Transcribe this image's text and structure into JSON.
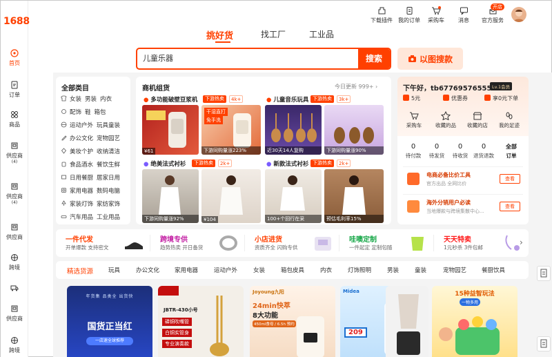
{
  "brand": {
    "logo": "1688",
    "accent": "#ff4000"
  },
  "sidebar": {
    "items": [
      {
        "label": "首页",
        "icon": "home-icon",
        "active": true
      },
      {
        "label": "订单",
        "icon": "order-icon"
      },
      {
        "label": "商品",
        "icon": "grid-icon"
      },
      {
        "label": "供应商",
        "sub": "(4)",
        "icon": "supplier-icon"
      },
      {
        "label": "供应商",
        "sub": "(4)",
        "icon": "supplier-icon"
      },
      {
        "label": "供应商",
        "icon": "supplier-icon"
      },
      {
        "label": "跨境",
        "icon": "cross-border-icon"
      },
      {
        "label": "",
        "icon": "truck-icon"
      },
      {
        "label": "供应商",
        "icon": "supplier-icon"
      },
      {
        "label": "跨境",
        "icon": "cross-border-icon"
      }
    ]
  },
  "topbar": {
    "items": [
      {
        "label": "下载插件",
        "icon": "plugin-icon"
      },
      {
        "label": "我的订单",
        "icon": "order-icon"
      },
      {
        "label": "采购车",
        "icon": "cart-icon"
      },
      {
        "label": "消息",
        "icon": "message-icon"
      },
      {
        "label": "官方服务",
        "icon": "service-icon"
      }
    ],
    "open_badge": "开店"
  },
  "search": {
    "tabs": [
      "挑好货",
      "找工厂",
      "工业品"
    ],
    "value": "儿童乐器",
    "button": "搜索",
    "image_button": "以图搜款"
  },
  "categories": {
    "title": "全部类目",
    "rows": [
      [
        "女装",
        "男装",
        "内衣"
      ],
      [
        "配饰",
        "鞋",
        "箱包"
      ],
      [
        "运动户外",
        "玩具童装"
      ],
      [
        "办公文化",
        "宠物园艺"
      ],
      [
        "美妆个护",
        "收纳清洁"
      ],
      [
        "食品酒水",
        "餐饮生鲜"
      ],
      [
        "日用餐厨",
        "居家日用"
      ],
      [
        "家用电器",
        "数码电脑"
      ],
      [
        "家装灯饰",
        "家纺家饰"
      ],
      [
        "汽车用品",
        "工业用品"
      ]
    ]
  },
  "groups": {
    "title": "商机组货",
    "update": "今日更新 999+ ›",
    "hot_label": "下游热卖",
    "items": [
      {
        "title": "多功能破壁豆浆机",
        "count": "4k+",
        "badges": [
          "干湿直打",
          "免手洗"
        ],
        "price": "¥61",
        "caption": "下游同购量涨223%"
      },
      {
        "title": "儿童音乐玩具",
        "count": "3k+",
        "badges": [],
        "price": "",
        "caption": "近30天14人复购",
        "caption2": "下游同购量涨90%"
      },
      {
        "title": "绝美法式衬衫",
        "count": "2k+",
        "badges": [],
        "price": "¥104",
        "caption": "下游同购量涨92%"
      },
      {
        "title": "新款法式衬衫",
        "count": "2k+",
        "badges": [],
        "price": "",
        "caption": "100+个回行在采",
        "caption2": "预估毛利率15%"
      }
    ]
  },
  "user": {
    "greeting": "下午好，tb677695765552",
    "level": "Lv.1会员",
    "stats": [
      {
        "label": "5元"
      },
      {
        "label": "优惠券"
      },
      {
        "label": "享0元下单"
      }
    ],
    "tools": [
      "采购车",
      "收藏的品",
      "收藏的店",
      "我的足迹"
    ],
    "orders": [
      {
        "value": "0",
        "label": "待付款"
      },
      {
        "value": "0",
        "label": "待发货"
      },
      {
        "value": "0",
        "label": "待收货"
      },
      {
        "value": "0",
        "label": "退货退款"
      },
      {
        "value": "全部",
        "label": "订单"
      }
    ],
    "promos": [
      {
        "title": "电商必备比价工具",
        "sub": "官方出品 全网比价",
        "button": "查看"
      },
      {
        "title": "海外分销用户必读",
        "sub": "当地爆款与跨境集散中心...",
        "button": "查看"
      }
    ]
  },
  "promo_strip": [
    {
      "title": "一件代发",
      "sub": "开单爆款 支持密文",
      "color": "#ff4000"
    },
    {
      "title": "跨境专供",
      "sub": "趋势热卖 开日备货",
      "color": "#c31ea3"
    },
    {
      "title": "小店进货",
      "sub": "资质齐全 闪购专供",
      "color": "#ff4000"
    },
    {
      "title": "哇噢定制",
      "sub": "一件起定 定制包随",
      "color": "#1aa84a"
    },
    {
      "title": "天天特卖",
      "sub": "1元秒杀 3件包邮",
      "color": "#ff1a1a"
    }
  ],
  "tabs": [
    "精选货源",
    "玩具",
    "办公文化",
    "家用电器",
    "运动户外",
    "女装",
    "箱包皮具",
    "内衣",
    "灯饰照明",
    "男装",
    "童装",
    "宠物园艺",
    "餐厨饮具"
  ],
  "products": [
    {
      "top": "国货正当红",
      "btn": "一店速全球推荐",
      "labels": [
        "年货集",
        "品类全",
        "出货快"
      ]
    },
    {
      "top": "JBTR-430小号",
      "labels": [
        "磷铜吹嘴管",
        "白铜实管身",
        "专业演奏款"
      ]
    },
    {
      "top": "Joyoung九阳",
      "labels": [
        "24min快萃",
        "8大功能",
        "450ml食母 / 6.5h 预约"
      ]
    },
    {
      "top": "Midea",
      "labels": [
        "209"
      ]
    },
    {
      "top": "",
      "labels": []
    },
    {
      "top": "15种益智玩法",
      "labels": [
        "一物多用"
      ]
    }
  ]
}
